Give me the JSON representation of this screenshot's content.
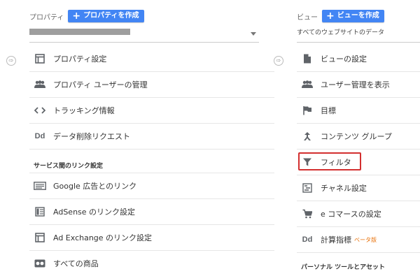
{
  "property": {
    "label": "プロパティ",
    "create_button": "プロパティを作成",
    "items": [
      {
        "label": "プロパティ設定",
        "icon": "window-icon"
      },
      {
        "label": "プロパティ ユーザーの管理",
        "icon": "people-icon"
      },
      {
        "label": "トラッキング情報",
        "icon": "code-icon"
      },
      {
        "label": "データ削除リクエスト",
        "icon": "dd-icon",
        "icon_text": "Dd"
      }
    ],
    "section_title": "サービス間のリンク設定",
    "links": [
      {
        "label": "Google 広告とのリンク",
        "icon": "google-ads-icon"
      },
      {
        "label": "AdSense のリンク設定",
        "icon": "adsense-icon"
      },
      {
        "label": "Ad Exchange のリンク設定",
        "icon": "ad-exchange-icon"
      },
      {
        "label": "すべての商品",
        "icon": "all-products-icon"
      }
    ]
  },
  "view": {
    "label": "ビュー",
    "create_button": "ビューを作成",
    "selected_view": "すべてのウェブサイトのデータ",
    "items": [
      {
        "label": "ビューの設定",
        "icon": "document-icon"
      },
      {
        "label": "ユーザー管理を表示",
        "icon": "people-icon"
      },
      {
        "label": "目標",
        "icon": "flag-icon"
      },
      {
        "label": "コンテンツ グループ",
        "icon": "content-group-icon"
      },
      {
        "label": "フィルタ",
        "icon": "filter-icon"
      },
      {
        "label": "チャネル設定",
        "icon": "channel-icon"
      },
      {
        "label": "e コマースの設定",
        "icon": "cart-icon"
      },
      {
        "label": "計算指標",
        "icon": "dd-icon",
        "icon_text": "Dd",
        "badge": "ベータ版"
      }
    ],
    "section_title": "パーソナル ツールとアセット"
  },
  "colors": {
    "accent": "#4285f4",
    "highlight": "#d32f2f",
    "beta": "#e8710a"
  }
}
